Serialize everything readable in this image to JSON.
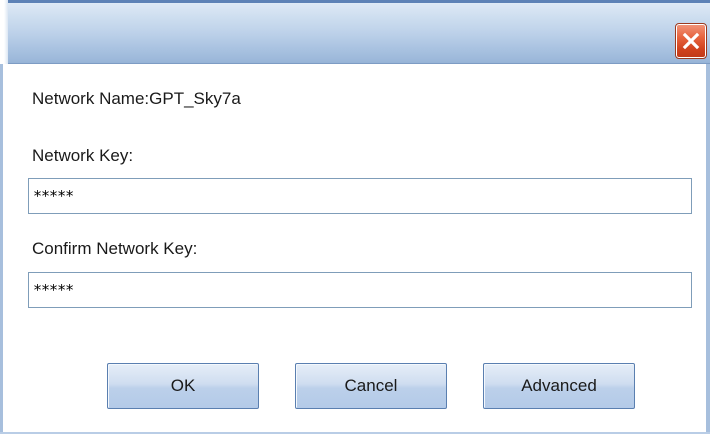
{
  "window": {
    "title": "",
    "close_icon": "close-icon"
  },
  "fields": {
    "network_name_label": "Network Name:GPT_Sky7a",
    "network_key_label": "Network Key:",
    "network_key_value": "*****",
    "confirm_key_label": "Confirm Network Key:",
    "confirm_key_value": "*****"
  },
  "buttons": {
    "ok": "OK",
    "cancel": "Cancel",
    "advanced": "Advanced"
  },
  "colors": {
    "titlebar": "#bed2ea",
    "close_button": "#e6623d",
    "button_face": "#cfddf0",
    "input_border": "#7f9db9"
  }
}
